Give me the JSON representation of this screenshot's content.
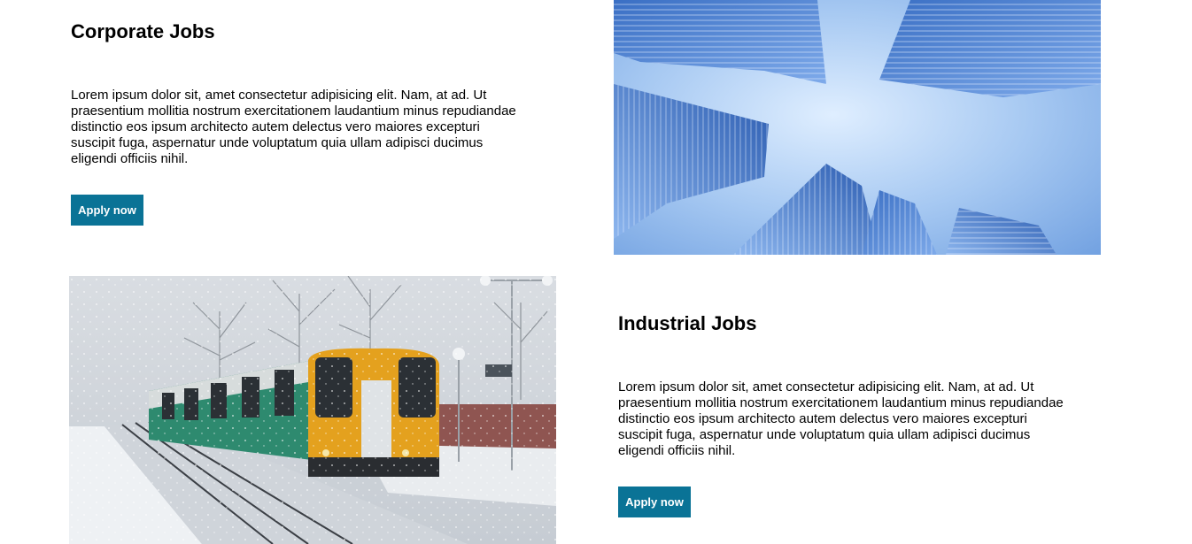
{
  "sections": {
    "corporate": {
      "title": "Corporate Jobs",
      "body": "Lorem ipsum dolor sit, amet consectetur adipisicing elit. Nam, at ad. Ut praesentium mollitia nostrum exercitationem laudantium minus repudiandae distinctio eos ipsum architecto autem delectus vero maiores excepturi suscipit fuga, aspernatur unde voluptatum quia ullam adipisci ducimus eligendi officiis nihil.",
      "button_label": "Apply now",
      "image": "skyscrapers-looking-up-photo"
    },
    "industrial": {
      "title": "Industrial Jobs",
      "body": "Lorem ipsum dolor sit, amet consectetur adipisicing elit. Nam, at ad. Ut praesentium mollitia nostrum exercitationem laudantium minus repudiandae distinctio eos ipsum architecto autem delectus vero maiores excepturi suscipit fuga, aspernatur unde voluptatum quia ullam adipisci ducimus eligendi officiis nihil.",
      "button_label": "Apply now",
      "image": "train-in-snow-photo"
    }
  },
  "colors": {
    "button_bg": "#0a7396",
    "button_text": "#ffffff",
    "background": "#ffffff"
  }
}
